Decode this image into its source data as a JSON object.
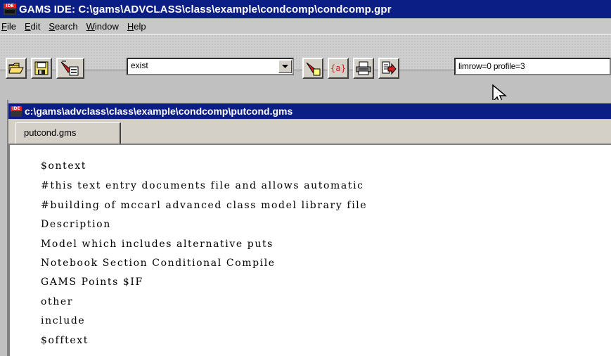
{
  "window": {
    "title": "GAMS IDE: C:\\gams\\ADVCLASS\\class\\example\\condcomp\\condcomp.gpr",
    "icon_text": "IDE"
  },
  "menu": [
    {
      "label": "File",
      "underline": "F",
      "rest": "ile"
    },
    {
      "label": "Edit",
      "underline": "E",
      "rest": "dit"
    },
    {
      "label": "Search",
      "underline": "S",
      "rest": "earch"
    },
    {
      "label": "Window",
      "underline": "W",
      "rest": "indow"
    },
    {
      "label": "Help",
      "underline": "H",
      "rest": "elp"
    }
  ],
  "toolbar": {
    "open_icon": "folder-open-icon",
    "save_icon": "floppy-disk-icon",
    "find_icon": "flashlight-search-icon",
    "combo_value": "exist",
    "mark_icon": "highlighter-icon",
    "brace_label": "{a}",
    "print_icon": "printer-icon",
    "run_icon": "run-arrow-icon",
    "param_value": "limrow=0 profile=3"
  },
  "document": {
    "title": "c:\\gams\\advclass\\class\\example\\condcomp\\putcond.gms",
    "tab_label": "putcond.gms",
    "lines": [
      "$ontext",
      "#this text entry documents file and allows automatic",
      "#building of mccarl advanced class model library file",
      "Description",
      "Model which includes alternative puts",
      "Notebook Section Conditional Compile",
      "GAMS Points $IF",
      "other",
      "include",
      "$offtext"
    ]
  },
  "colors": {
    "titlebar": "#0a1e86",
    "face": "#d4d0c8",
    "editor_bg": "#ffffff"
  }
}
